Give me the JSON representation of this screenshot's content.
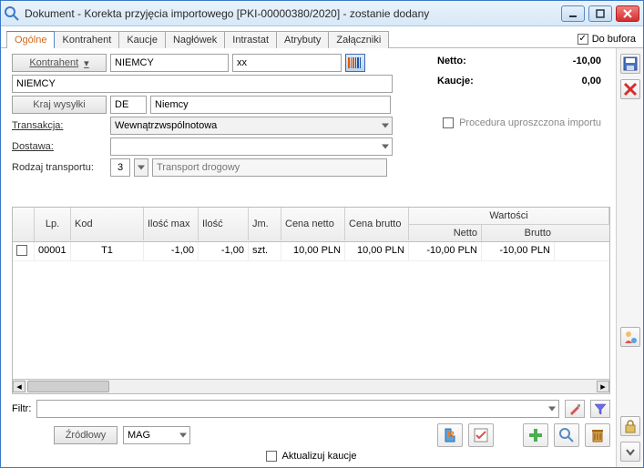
{
  "window": {
    "title": "Dokument - Korekta przyjęcia importowego [PKI-00000380/2020]  - zostanie dodany"
  },
  "tabs": [
    "Ogólne",
    "Kontrahent",
    "Kaucje",
    "Nagłówek",
    "Intrastat",
    "Atrybuty",
    "Załączniki"
  ],
  "active_tab": "Ogólne",
  "buffer_label": "Do bufora",
  "buffer_checked": true,
  "form": {
    "kontrahent_label": "Kontrahent",
    "kontrahent_value": "NIEMCY",
    "kontrahent_code": "xx",
    "kontrahent_long": "NIEMCY",
    "kraj_label": "Kraj wysyłki",
    "kraj_code": "DE",
    "kraj_name": "Niemcy",
    "transakcja_label": "Transakcja:",
    "transakcja_value": "Wewnątrzwspólnotowa",
    "dostawa_label": "Dostawa:",
    "dostawa_value": "",
    "rodzaj_label": "Rodzaj transportu:",
    "rodzaj_code": "3",
    "rodzaj_text": "Transport drogowy"
  },
  "summary": {
    "netto_label": "Netto:",
    "netto_value": "-10,00",
    "kaucje_label": "Kaucje:",
    "kaucje_value": "0,00"
  },
  "procedure": {
    "label": "Procedura uproszczona importu",
    "checked": false
  },
  "grid": {
    "group_wartosci": "Wartości",
    "headers": {
      "lp": "Lp.",
      "kod": "Kod",
      "imax": "Ilość max",
      "ilosc": "Ilość",
      "jm": "Jm.",
      "cn": "Cena netto",
      "cb": "Cena brutto",
      "wn": "Netto",
      "wb": "Brutto"
    },
    "rows": [
      {
        "lp": "00001",
        "kod": "T1",
        "imax": "-1,00",
        "ilosc": "-1,00",
        "jm": "szt.",
        "cn": "10,00 PLN",
        "cb": "10,00 PLN",
        "wn": "-10,00 PLN",
        "wb": "-10,00 PLN"
      }
    ]
  },
  "filter": {
    "label": "Filtr:",
    "value": ""
  },
  "source": {
    "label": "Źródłowy",
    "value": "MAG"
  },
  "update_kaucje": {
    "label": "Aktualizuj kaucje",
    "checked": false
  }
}
